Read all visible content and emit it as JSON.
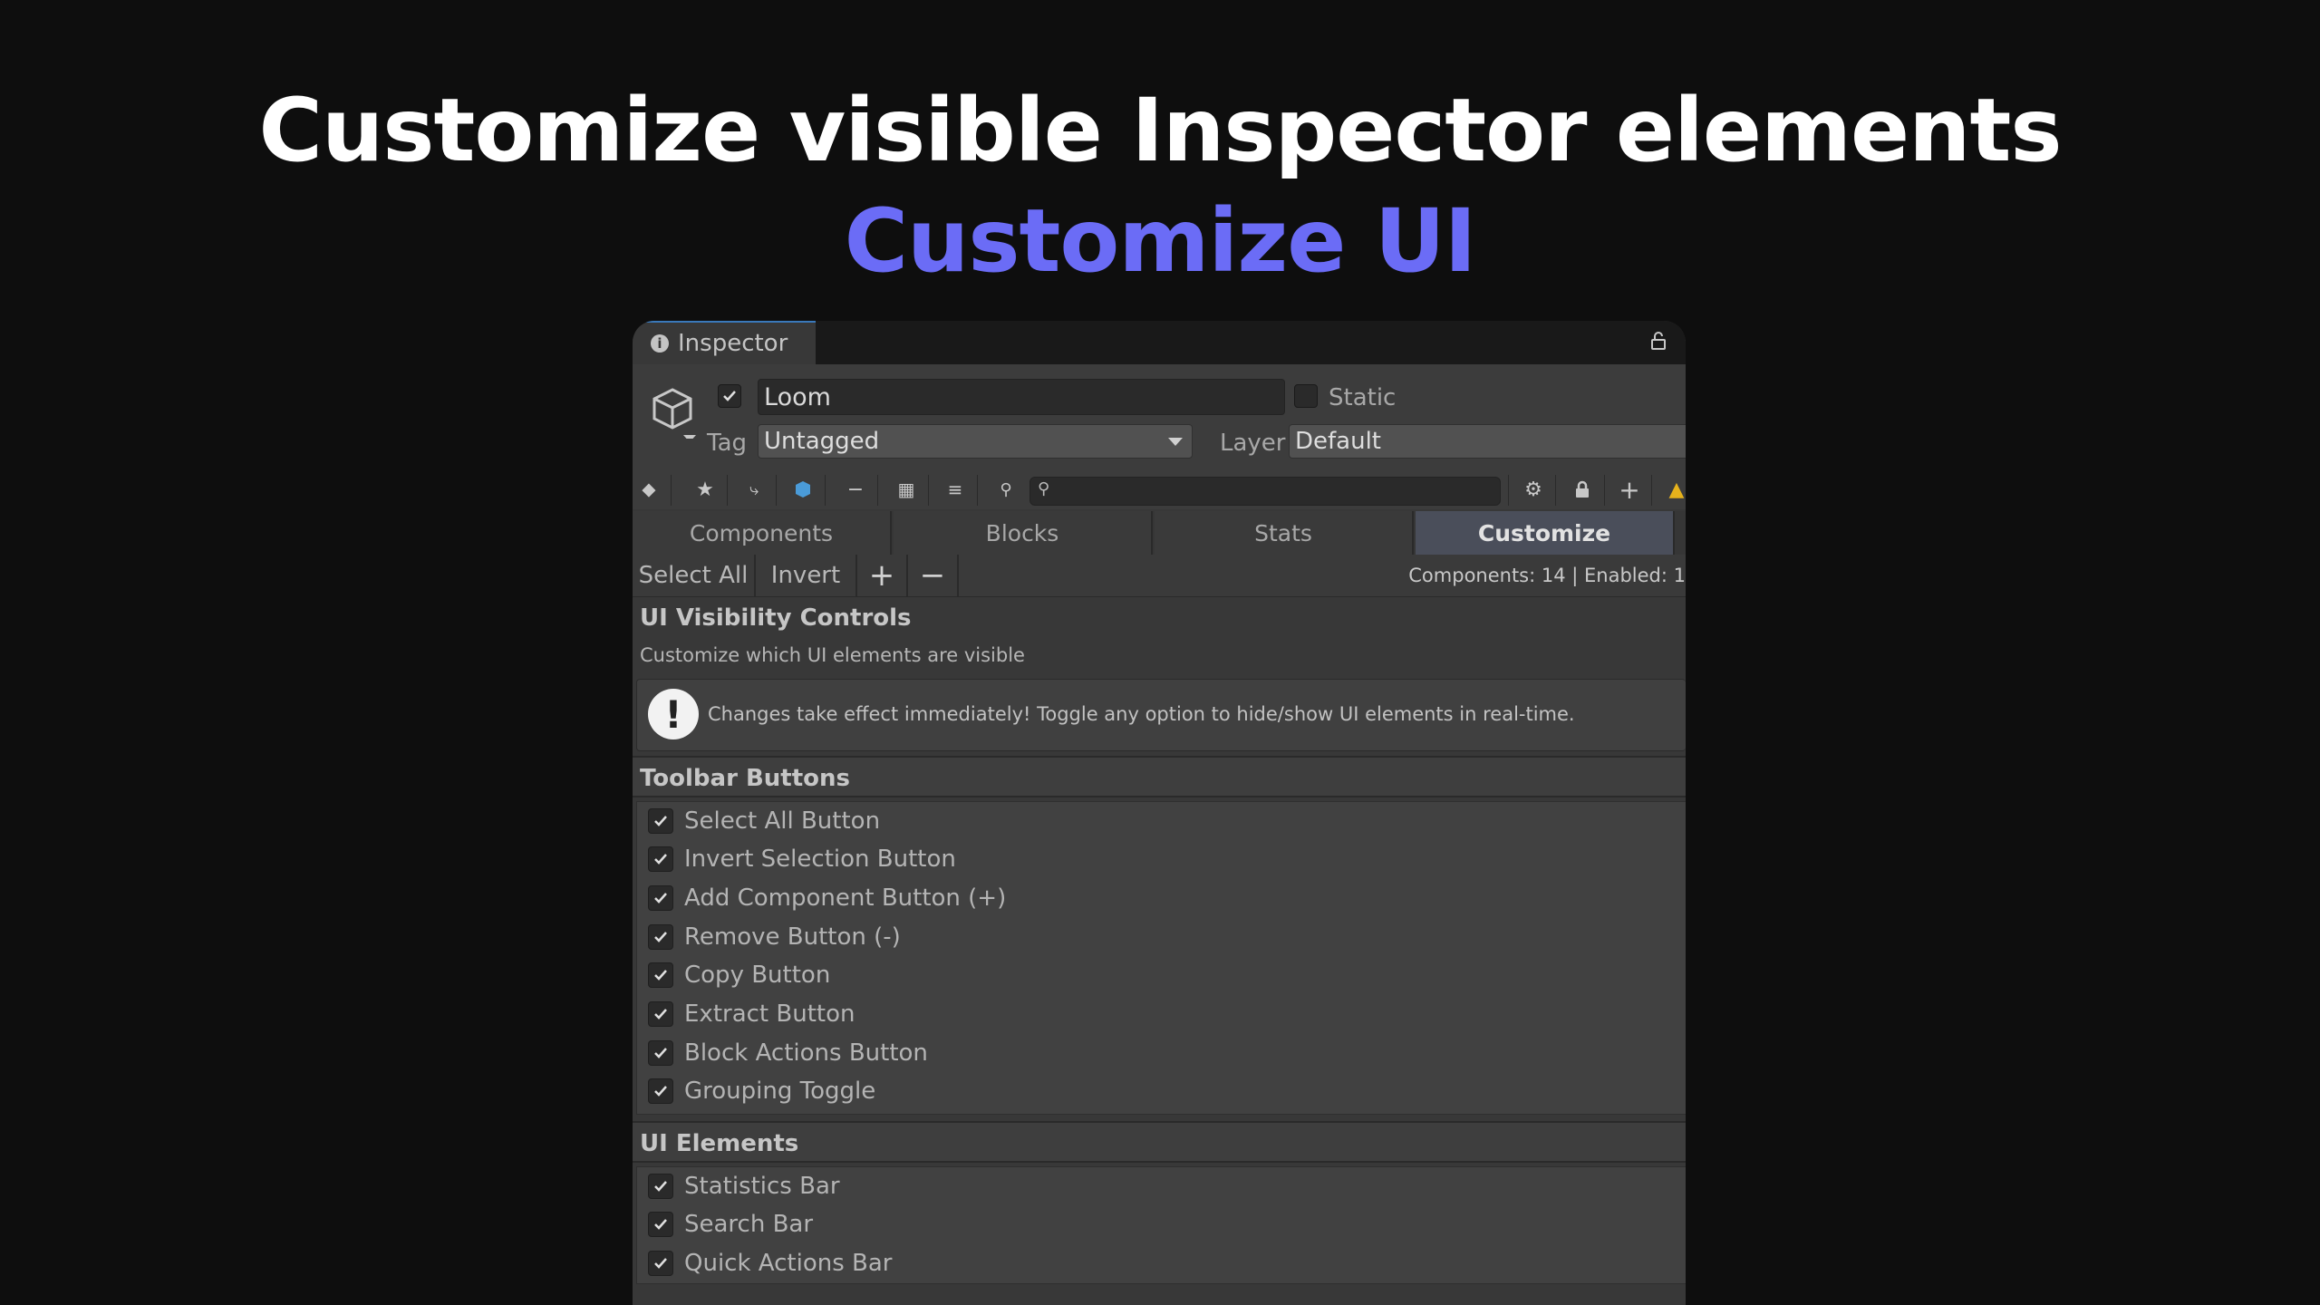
{
  "headline": "Customize visible Inspector elements",
  "subheadline": "Customize UI",
  "window": {
    "tab_title": "Inspector",
    "object_name": "Loom",
    "static_label": "Static",
    "tag_label": "Tag",
    "tag_value": "Untagged",
    "layer_label": "Layer",
    "layer_value": "Default",
    "search_placeholder": ""
  },
  "toolbar_icons": [
    "tag-icon",
    "star-icon",
    "hierarchy-icon",
    "prefab-icon",
    "minus-icon",
    "save-icon",
    "list-icon",
    "search-icon",
    "gear-icon",
    "lock-icon",
    "plus-icon",
    "warning-icon"
  ],
  "tabs": [
    "Components",
    "Blocks",
    "Stats",
    "Customize"
  ],
  "active_tab": "Customize",
  "actions": {
    "select_all": "Select All",
    "invert": "Invert",
    "add": "+",
    "remove": "−",
    "stats": "Components: 14 | Enabled: 1"
  },
  "controls": {
    "title": "UI Visibility Controls",
    "subtitle": "Customize which UI elements are visible",
    "help": "Changes take effect immediately! Toggle any option to hide/show UI elements in real-time."
  },
  "toolbar_section": {
    "title": "Toolbar Buttons",
    "items": [
      "Select All Button",
      "Invert Selection Button",
      "Add Component Button (+)",
      "Remove Button (-)",
      "Copy Button",
      "Extract Button",
      "Block Actions Button",
      "Grouping Toggle"
    ]
  },
  "ui_section": {
    "title": "UI Elements",
    "items": [
      "Statistics Bar",
      "Search Bar",
      "Quick Actions Bar"
    ]
  },
  "colors": {
    "accent": "#6b6cf6",
    "background": "#0e0e0e",
    "panel": "#383838",
    "warning": "#e6b21c"
  }
}
